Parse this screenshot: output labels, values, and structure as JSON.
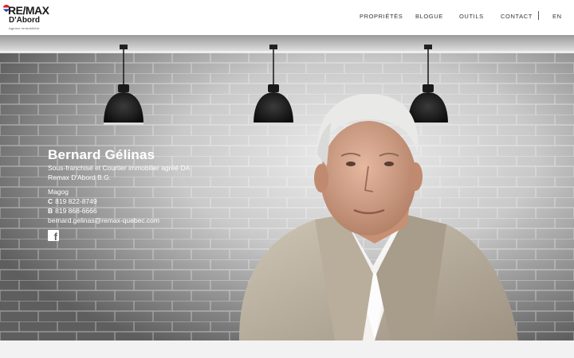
{
  "brand": {
    "name": "RE/MAX",
    "office": "D'Abord",
    "tagline": "Agence immobilière",
    "colors": {
      "red": "#dc1c2e",
      "blue": "#003da5"
    }
  },
  "nav": {
    "items": [
      "PROPRIÉTÉS",
      "BLOGUE",
      "OUTILS",
      "CONTACT"
    ],
    "language": "EN"
  },
  "agent": {
    "name": "Bernard Gélinas",
    "title": "Sous-franchisé et Courtier immobilier agréé DA",
    "agency": "Remax D'Abord B.G.",
    "city": "Magog",
    "cell_label": "C",
    "cell": "819 822-8749",
    "office_label": "B",
    "office_phone": "819 868-6666",
    "email": "bernard.gelinas@remax-quebec.com",
    "social_icon": "facebook-icon"
  }
}
